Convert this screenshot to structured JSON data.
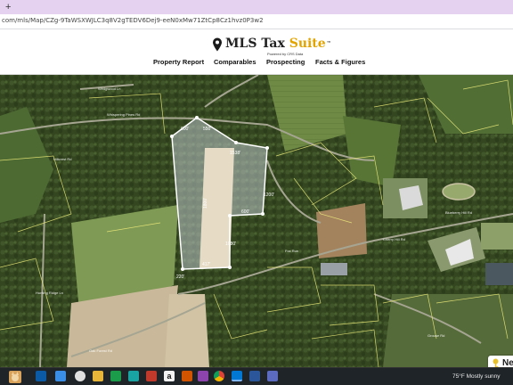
{
  "browser": {
    "new_tab_label": "+",
    "url": "com/mls/Map/CZg-9TaWSXWJLC3q8V2gTEDV6Dej9-eeN0xMw71ZtCp8Cz1hvz0P3w2"
  },
  "header": {
    "logo_main": "MLS Tax ",
    "logo_accent": "Suite",
    "logo_tm": "™",
    "powered_by": "Powered by CRS Data",
    "nav": [
      {
        "label": "Property Report"
      },
      {
        "label": "Comparables"
      },
      {
        "label": "Prospecting"
      },
      {
        "label": "Facts & Figures"
      }
    ]
  },
  "map": {
    "boundary_color": "#ffffff",
    "parcel_color": "#f0ee7a",
    "road_labels": {
      "a": "Wedgwood Ln",
      "b": "Whispering Pines Rd",
      "c": "Cherry Hill Rd",
      "d": "Hillcrest Rd",
      "e": "Fox Run",
      "f": "Blueberry Hill Rd",
      "g": "Oak Forest Rd",
      "h": "Grouse Rd",
      "i": "Hunting Ridge Ln"
    },
    "dimensions": {
      "top_left": "600'",
      "top_edge": "1538'",
      "left_edge": "1800'",
      "right_mid": "1200'",
      "right_step": "600'",
      "right_lower": "1080'",
      "bottom_edge": "417'",
      "bottom_left": "220'",
      "top_right": "550'"
    }
  },
  "taskbar": {
    "weather": "75°F  Mostly sunny",
    "notification": "Ne"
  }
}
